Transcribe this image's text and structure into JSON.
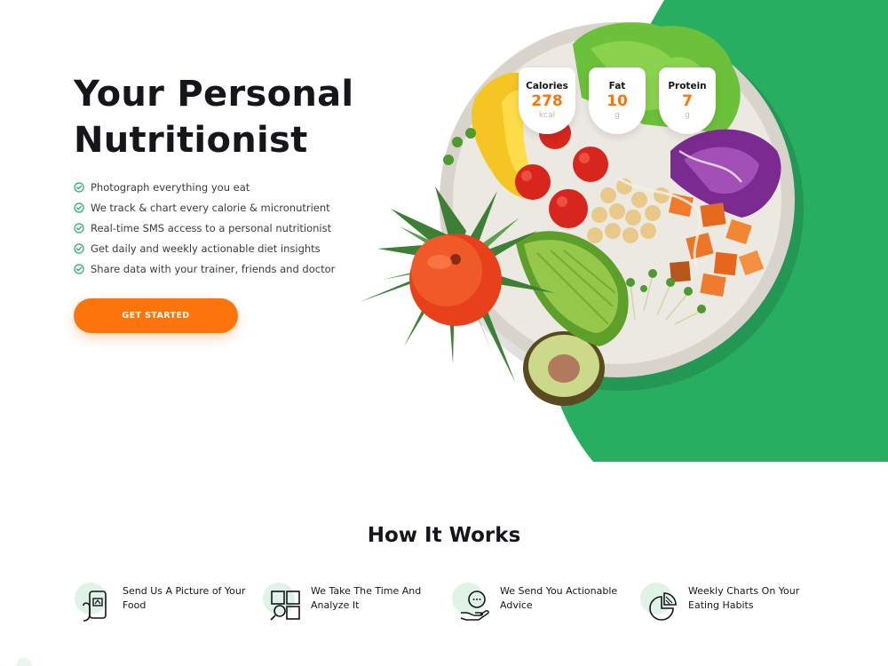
{
  "hero": {
    "title": "Your Personal Nutritionist",
    "features": [
      "Photograph everything you eat",
      "We track & chart every calorie & micronutrient",
      "Real-time SMS access to a personal nutritionist",
      "Get daily and weekly actionable diet insights",
      "Share data with your trainer, friends and doctor"
    ],
    "cta_label": "GET STARTED"
  },
  "nutrition": [
    {
      "label": "Calories",
      "value": "278",
      "unit": "kcal"
    },
    {
      "label": "Fat",
      "value": "10",
      "unit": "g"
    },
    {
      "label": "Protein",
      "value": "7",
      "unit": "g"
    }
  ],
  "how_it_works": {
    "title": "How It Works",
    "steps": [
      {
        "text": "Send Us A Picture of Your Food",
        "icon": "phone-camera-icon"
      },
      {
        "text": "We Take The Time And Analyze It",
        "icon": "analyze-grid-icon"
      },
      {
        "text": "We Send You Actionable Advice",
        "icon": "chat-hand-icon"
      },
      {
        "text": "Weekly Charts On Your Eating Habits",
        "icon": "pie-chart-icon"
      }
    ]
  },
  "colors": {
    "brand_green": "#27ae60",
    "accent_orange": "#fd740d",
    "text_dark": "#15161a",
    "icon_blob": "#dff3e6"
  }
}
